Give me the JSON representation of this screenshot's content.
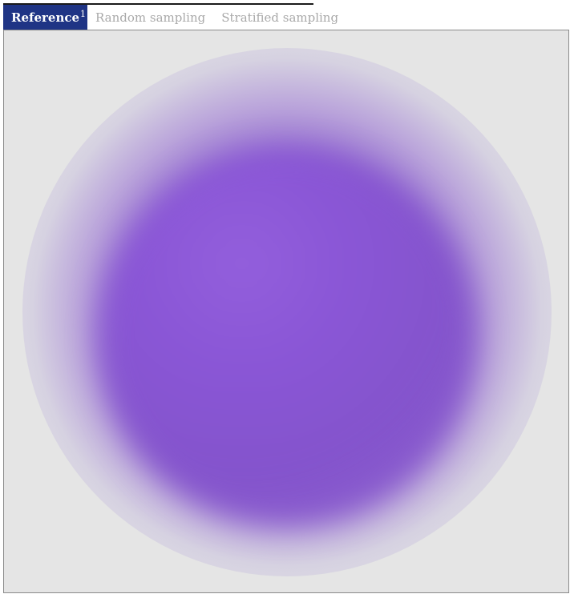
{
  "tabs": [
    {
      "label": "Reference",
      "footnote": "1",
      "active": true
    },
    {
      "label": "Random sampling",
      "active": false
    },
    {
      "label": "Stratified sampling",
      "active": false
    }
  ],
  "colors": {
    "active_tab_bg": "#1f3485",
    "inactive_tab_text": "#a9a9a9",
    "viewport_bg": "#e5e5e5",
    "sphere": "#8654cf"
  }
}
